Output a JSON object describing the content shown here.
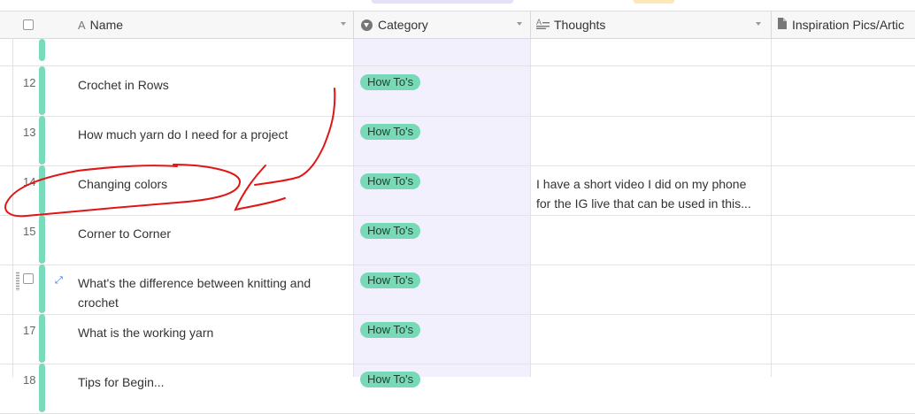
{
  "header": {
    "columns": [
      {
        "label": "Name",
        "icon": "text-icon"
      },
      {
        "label": "Category",
        "icon": "select-icon"
      },
      {
        "label": "Thoughts",
        "icon": "long-text-icon"
      },
      {
        "label": "Inspiration Pics/Artic",
        "icon": "file-icon"
      }
    ]
  },
  "rows": [
    {
      "num": "12",
      "name": "Crochet in Rows",
      "category": "How To's",
      "thought": ""
    },
    {
      "num": "13",
      "name": "How much yarn do I need for a project",
      "category": "How To's",
      "thought": ""
    },
    {
      "num": "14",
      "name": "Changing colors",
      "category": "How To's",
      "thought_line1": "I have a short video I did on my phone",
      "thought_line2": "for the IG live that can be used in this..."
    },
    {
      "num": "15",
      "name": "Corner to Corner",
      "category": "How To's",
      "thought": ""
    },
    {
      "num": "",
      "name_line1": "What's the difference between knitting and",
      "name_line2": "crochet",
      "category": "How To's",
      "thought": ""
    },
    {
      "num": "17",
      "name": "What is the working yarn",
      "category": "How To's",
      "thought": ""
    },
    {
      "num": "18",
      "name": "Tips for Begin...",
      "category": "How To's",
      "thought": ""
    }
  ],
  "colors": {
    "accent_bar": "#79dbbb",
    "tag_bg": "#78d9b7",
    "category_column_bg": "#f3f0fe",
    "annotation": "#e01616"
  }
}
